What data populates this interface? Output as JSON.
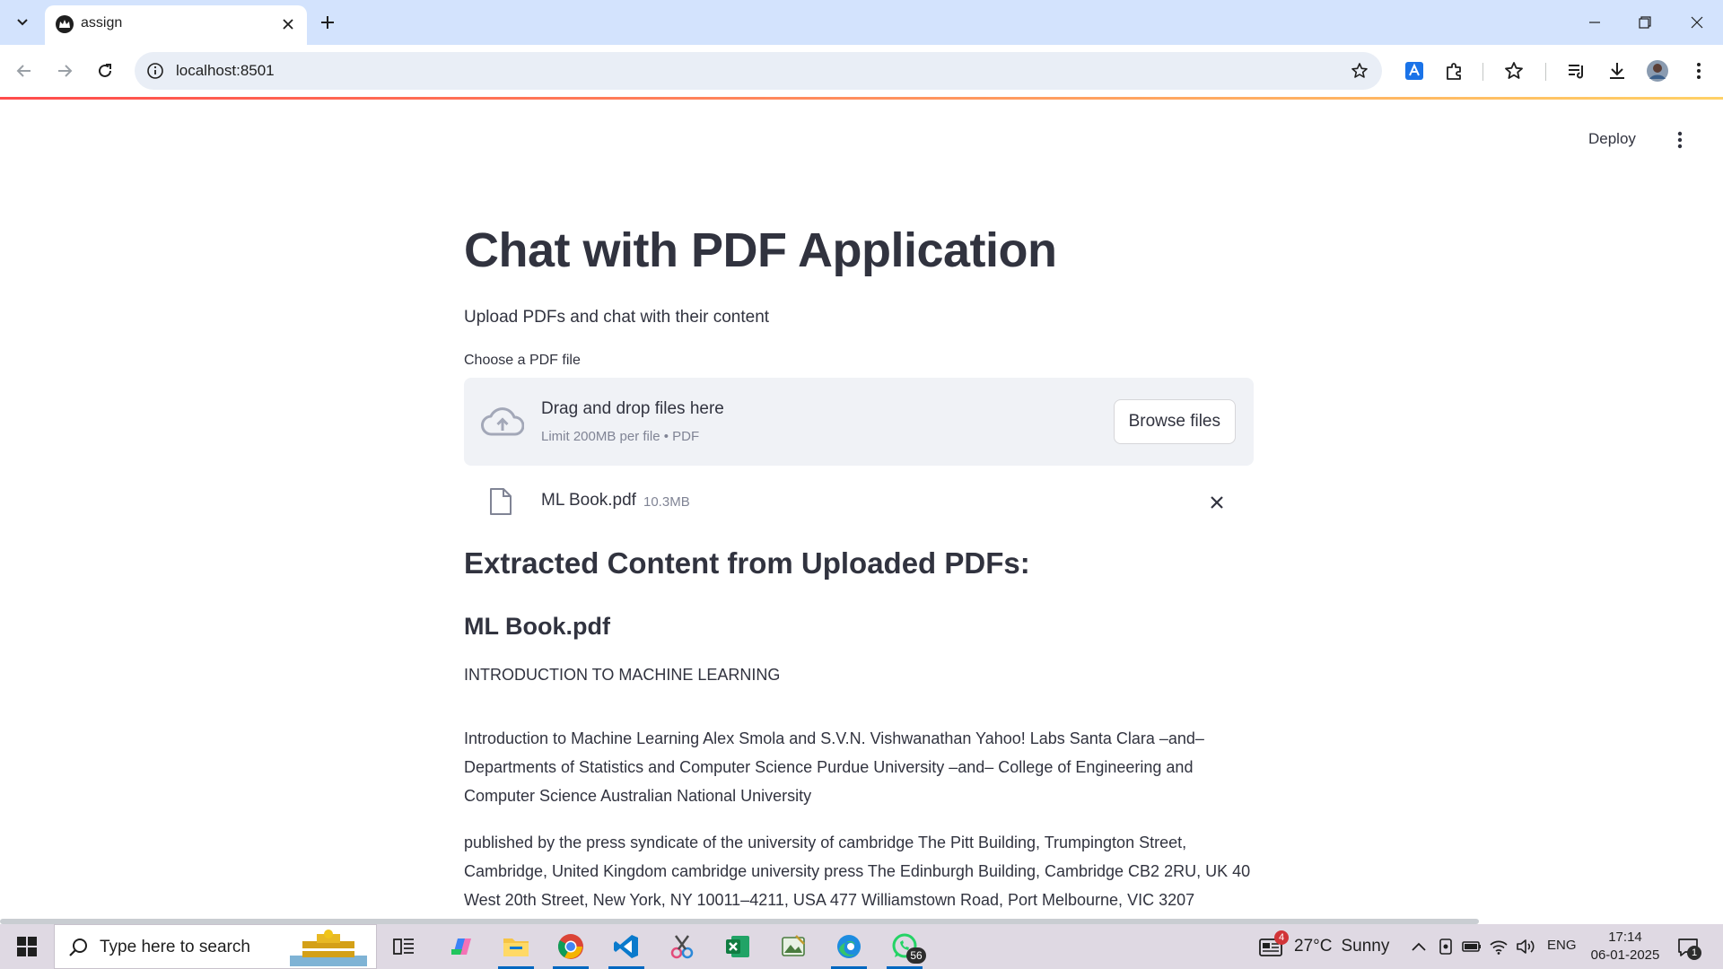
{
  "browser": {
    "tab_title": "assign",
    "url": "localhost:8501"
  },
  "app": {
    "deploy_label": "Deploy",
    "title": "Chat with PDF Application",
    "subtitle": "Upload PDFs and chat with their content",
    "uploader": {
      "label": "Choose a PDF file",
      "drop_text": "Drag and drop files here",
      "limit_text": "Limit 200MB per file • PDF",
      "browse_label": "Browse files"
    },
    "uploaded_file": {
      "name": "ML Book.pdf",
      "size": "10.3MB"
    },
    "extracted_heading": "Extracted Content from Uploaded PDFs:",
    "document_heading": "ML Book.pdf",
    "doc_title_line": "INTRODUCTION TO MACHINE LEARNING",
    "paragraph_1": "Introduction to Machine Learning Alex Smola and S.V.N. Vishwanathan Yahoo! Labs Santa Clara –and– Departments of Statistics and Computer Science Purdue University –and– College of Engineering and Computer Science Australian National University",
    "paragraph_2": "published by the press syndicate of the university of cambridge The Pitt Building, Trumpington Street, Cambridge, United Kingdom cambridge university press The Edinburgh Building, Cambridge CB2 2RU, UK 40 West 20th Street, New York, NY 10011–4211, USA 477 Williamstown Road, Port Melbourne, VIC 3207"
  },
  "taskbar": {
    "search_placeholder": "Type here to search",
    "whatsapp_badge": "56",
    "weather_badge": "4",
    "weather_temp": "27°C",
    "weather_text": "Sunny",
    "language": "ENG",
    "time": "17:14",
    "date": "06-01-2025",
    "notification_count": "1"
  },
  "colors": {
    "accent": "#ff4b4b",
    "text": "#31333f",
    "muted": "#808495",
    "dropzone_bg": "#f0f2f6",
    "tabstrip_bg": "#d3e3fd",
    "taskbar_bg": "#dfd9e3"
  }
}
